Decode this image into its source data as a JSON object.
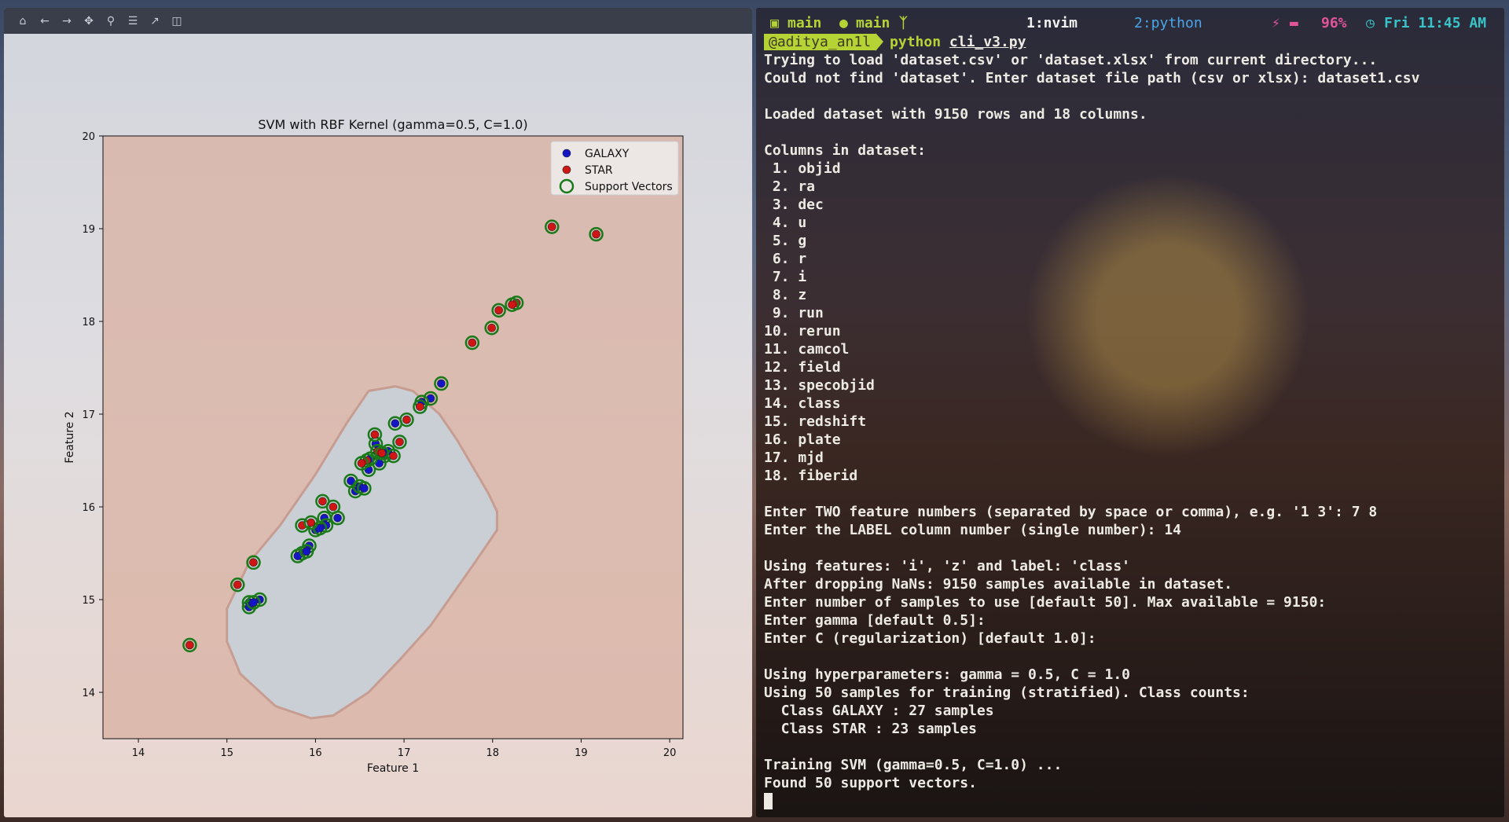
{
  "toolbar": {
    "icons": [
      "home-icon",
      "back-icon",
      "forward-icon",
      "pan-icon",
      "zoom-icon",
      "configure-icon",
      "edit-curve-icon",
      "save-icon"
    ]
  },
  "colors": {
    "galaxy": "#1515c8",
    "star": "#d01515",
    "support_vector_edge": "#1a7a1a",
    "region_galaxy": "#c6d2dc",
    "region_star": "#d9b0a2"
  },
  "chart_data": {
    "type": "scatter",
    "title": "SVM with RBF Kernel (gamma=0.5, C=1.0)",
    "xlabel": "Feature 1",
    "ylabel": "Feature 2",
    "xlim": [
      13.6,
      20.15
    ],
    "ylim": [
      13.5,
      20.0
    ],
    "xticks": [
      "14",
      "15",
      "16",
      "17",
      "18",
      "19",
      "20"
    ],
    "yticks": [
      "14",
      "15",
      "16",
      "17",
      "18",
      "19",
      "20"
    ],
    "legend_position": "top-right",
    "legend": [
      "GALAXY",
      "STAR",
      "Support Vectors"
    ],
    "series": [
      {
        "name": "GALAXY",
        "points": [
          [
            17.42,
            17.33
          ],
          [
            17.3,
            17.17
          ],
          [
            17.2,
            17.13
          ],
          [
            16.9,
            16.9
          ],
          [
            16.68,
            16.68
          ],
          [
            16.78,
            16.55
          ],
          [
            16.72,
            16.47
          ],
          [
            16.62,
            16.52
          ],
          [
            16.4,
            16.28
          ],
          [
            16.45,
            16.17
          ],
          [
            16.5,
            16.22
          ],
          [
            16.55,
            16.2
          ],
          [
            16.1,
            15.88
          ],
          [
            16.25,
            15.88
          ],
          [
            16.12,
            15.8
          ],
          [
            16.0,
            15.75
          ],
          [
            15.93,
            15.58
          ],
          [
            15.85,
            15.5
          ],
          [
            15.8,
            15.47
          ],
          [
            15.37,
            15.0
          ],
          [
            15.25,
            14.97
          ],
          [
            15.25,
            14.92
          ],
          [
            15.3,
            14.97
          ],
          [
            16.82,
            16.6
          ],
          [
            16.05,
            15.77
          ],
          [
            16.6,
            16.4
          ],
          [
            15.9,
            15.52
          ]
        ]
      },
      {
        "name": "STAR",
        "points": [
          [
            18.67,
            19.02
          ],
          [
            19.17,
            18.94
          ],
          [
            18.27,
            18.2
          ],
          [
            18.22,
            18.18
          ],
          [
            18.07,
            18.12
          ],
          [
            17.99,
            17.93
          ],
          [
            17.77,
            17.77
          ],
          [
            17.03,
            16.94
          ],
          [
            17.18,
            17.08
          ],
          [
            16.67,
            16.78
          ],
          [
            16.95,
            16.7
          ],
          [
            16.7,
            16.6
          ],
          [
            16.58,
            16.5
          ],
          [
            16.52,
            16.47
          ],
          [
            16.08,
            16.06
          ],
          [
            16.2,
            16.0
          ],
          [
            15.85,
            15.8
          ],
          [
            15.95,
            15.83
          ],
          [
            15.3,
            15.4
          ],
          [
            15.12,
            15.16
          ],
          [
            14.58,
            14.51
          ],
          [
            16.75,
            16.58
          ],
          [
            16.88,
            16.55
          ]
        ]
      }
    ],
    "decision_region": "GALAXY region enclosed, STAR elsewhere"
  },
  "terminal": {
    "status": {
      "session": "main",
      "branch": "main",
      "window1": "1:nvim",
      "window2": "2:python",
      "battery": "96%",
      "clock": "Fri 11:45 AM"
    },
    "prompt": {
      "user": "@aditya_an1l",
      "command": "python",
      "argument": "cli_v3.py"
    },
    "lines": [
      "Trying to load 'dataset.csv' or 'dataset.xlsx' from current directory...",
      "Could not find 'dataset'. Enter dataset file path (csv or xlsx): dataset1.csv",
      "",
      "Loaded dataset with 9150 rows and 18 columns.",
      "",
      "Columns in dataset:",
      " 1. objid",
      " 2. ra",
      " 3. dec",
      " 4. u",
      " 5. g",
      " 6. r",
      " 7. i",
      " 8. z",
      " 9. run",
      "10. rerun",
      "11. camcol",
      "12. field",
      "13. specobjid",
      "14. class",
      "15. redshift",
      "16. plate",
      "17. mjd",
      "18. fiberid",
      "",
      "Enter TWO feature numbers (separated by space or comma), e.g. '1 3': 7 8",
      "Enter the LABEL column number (single number): 14",
      "",
      "Using features: 'i', 'z' and label: 'class'",
      "After dropping NaNs: 9150 samples available in dataset.",
      "Enter number of samples to use [default 50]. Max available = 9150:",
      "Enter gamma [default 0.5]:",
      "Enter C (regularization) [default 1.0]:",
      "",
      "Using hyperparameters: gamma = 0.5, C = 1.0",
      "Using 50 samples for training (stratified). Class counts:",
      "  Class GALAXY : 27 samples",
      "  Class STAR : 23 samples",
      "",
      "Training SVM (gamma=0.5, C=1.0) ...",
      "Found 50 support vectors."
    ]
  }
}
